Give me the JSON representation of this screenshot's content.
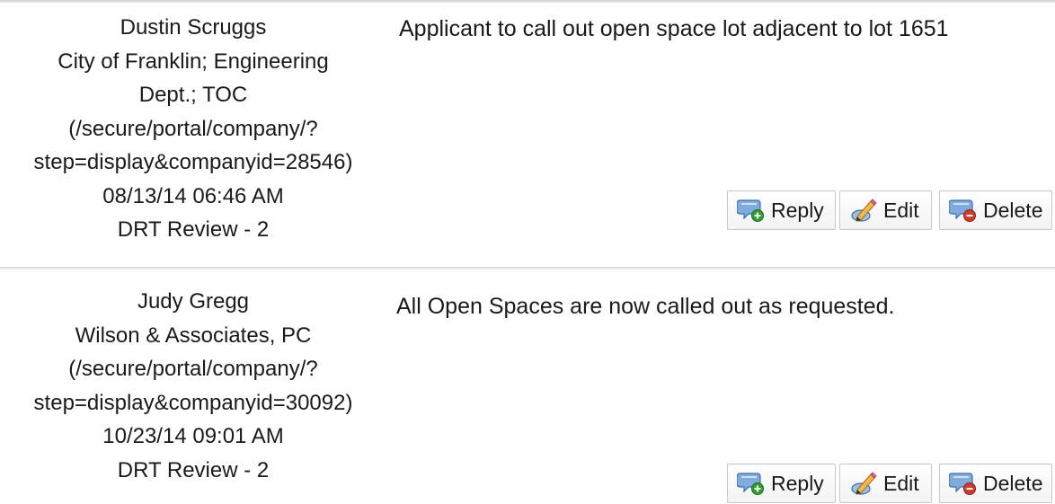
{
  "comments": [
    {
      "author": "Dustin Scruggs",
      "company_lines": [
        "City of Franklin; Engineering",
        "Dept.; TOC"
      ],
      "company_link_lines": [
        "(/secure/portal/company/?",
        "step=display&companyid=28546)"
      ],
      "timestamp": "08/13/14 06:46 AM",
      "review": "DRT Review - 2",
      "text": "Applicant to call out open space lot adjacent to lot 1651",
      "actions": {
        "reply": "Reply",
        "edit": "Edit",
        "delete": "Delete"
      }
    },
    {
      "author": "Judy Gregg",
      "company_lines": [
        "Wilson & Associates, PC"
      ],
      "company_link_lines": [
        "(/secure/portal/company/?",
        "step=display&companyid=30092)"
      ],
      "timestamp": "10/23/14 09:01 AM",
      "review": "DRT Review - 2",
      "text": "All Open Spaces are now called out as requested.",
      "actions": {
        "reply": "Reply",
        "edit": "Edit",
        "delete": "Delete"
      }
    }
  ],
  "icons": {
    "reply": "speech-bubble-plus-icon",
    "edit": "pencil-note-icon",
    "delete": "speech-bubble-minus-icon"
  },
  "colors": {
    "bubble": "#6f9fd8",
    "plus": "#2e9e2e",
    "minus": "#d23a2a",
    "pencil": "#e8a83a"
  }
}
